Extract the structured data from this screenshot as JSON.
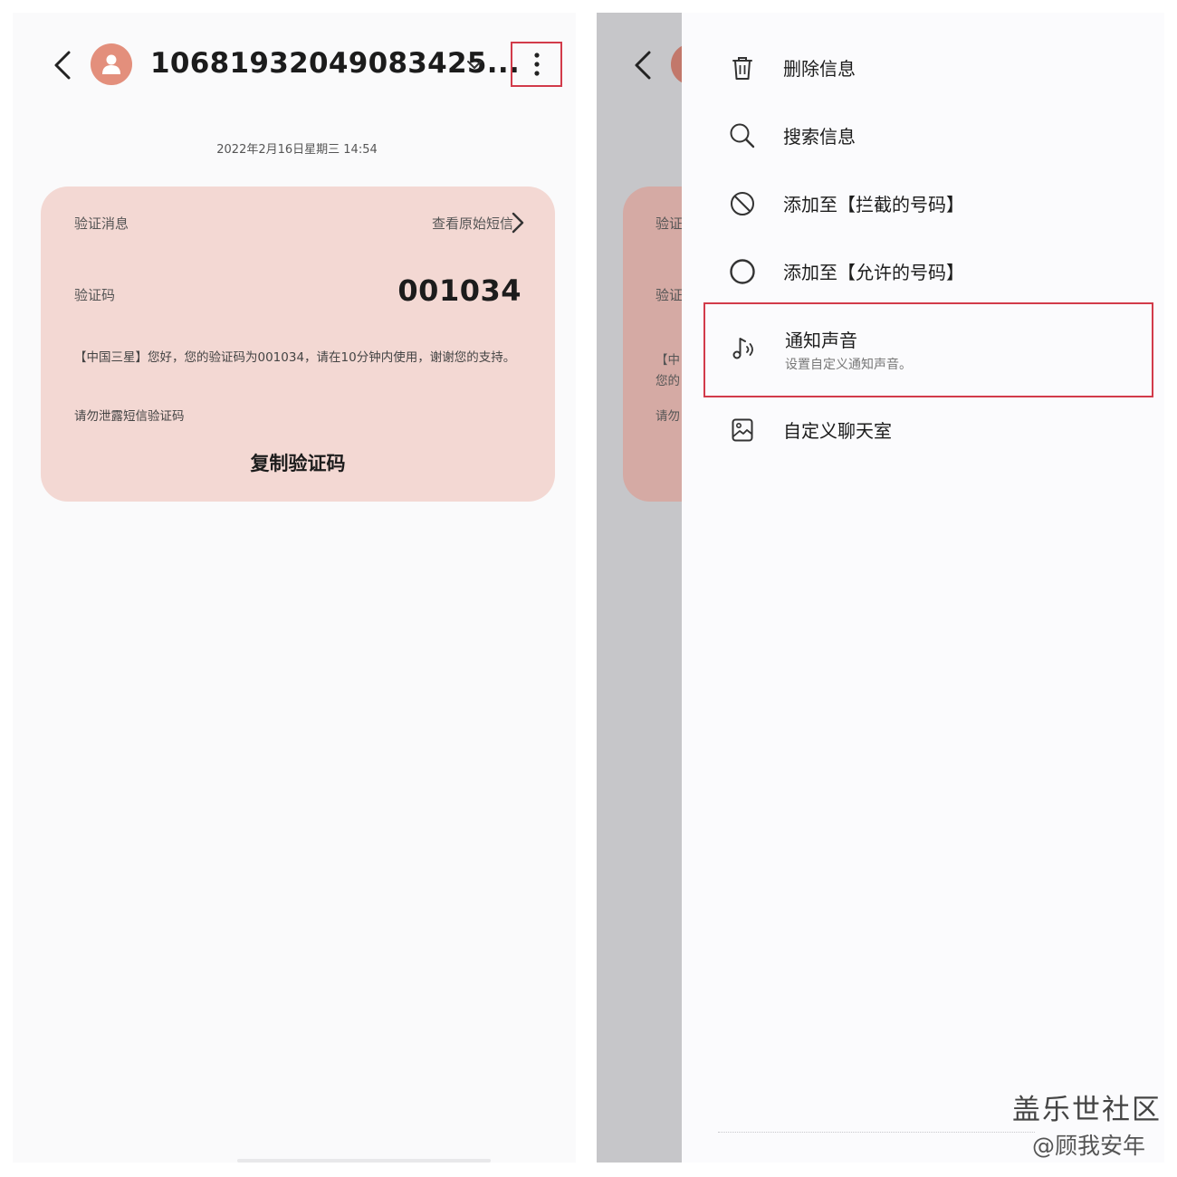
{
  "conversation": {
    "contact_number": "10681932049083425...",
    "timestamp": "2022年2月16日星期三 14:54"
  },
  "sms_card": {
    "header_label": "验证消息",
    "view_original": "查看原始短信",
    "code_label": "验证码",
    "code_value": "001034",
    "body": "【中国三星】您好，您的验证码为001034，请在10分钟内使用，谢谢您的支持。",
    "warning": "请勿泄露短信验证码",
    "copy_button": "复制验证码"
  },
  "background_preview": {
    "labels": [
      "验证",
      "验证",
      "【中",
      "您的",
      "请勿"
    ]
  },
  "menu": {
    "items": [
      {
        "label": "删除信息",
        "icon": "trash-icon"
      },
      {
        "label": "搜索信息",
        "icon": "search-icon"
      },
      {
        "label": "添加至【拦截的号码】",
        "icon": "block-icon"
      },
      {
        "label": "添加至【允许的号码】",
        "icon": "circle-icon"
      },
      {
        "label": "通知声音",
        "sublabel": "设置自定义通知声音。",
        "icon": "music-note-icon",
        "highlighted": true
      },
      {
        "label": "自定义聊天室",
        "icon": "wallpaper-icon"
      }
    ]
  },
  "watermark": {
    "title": "盖乐世社区",
    "author": "@顾我安年"
  },
  "colors": {
    "avatar": "#e38f7c",
    "card_bg": "#f3d8d3",
    "highlight_border": "#d23b4a",
    "overlay": "#c6c6c9"
  }
}
